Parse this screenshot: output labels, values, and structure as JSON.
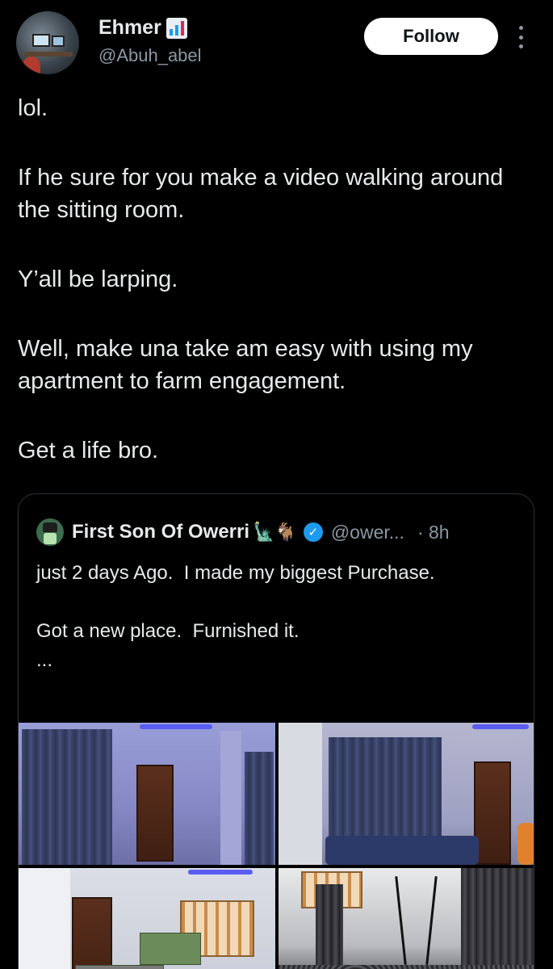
{
  "author": {
    "name": "Ehmer",
    "name_emoji_icon": "bar-chart-icon",
    "handle": "@Abuh_abel",
    "follow_label": "Follow"
  },
  "tweet": {
    "paragraphs": [
      "lol.",
      "If he sure for you make a video walking around the sitting room.",
      "Y’all be larping.",
      "Well, make una take am easy with using my apartment to farm engagement.",
      "Get a life bro."
    ]
  },
  "quoted": {
    "name": "First Son Of Owerri",
    "emoji": "🗽🐐",
    "handle": "@ower...",
    "time": "· 8h",
    "verified_icon": "verified-badge-icon",
    "lines": [
      "just 2 days Ago.  I made my biggest Purchase.",
      "Got a new place.  Furnished it.",
      "..."
    ],
    "media_count": 4
  },
  "colors": {
    "background": "#000000",
    "text": "#e7e9ea",
    "secondary": "#8b98a5",
    "verified": "#1d9bf0",
    "border": "#2f3336"
  }
}
